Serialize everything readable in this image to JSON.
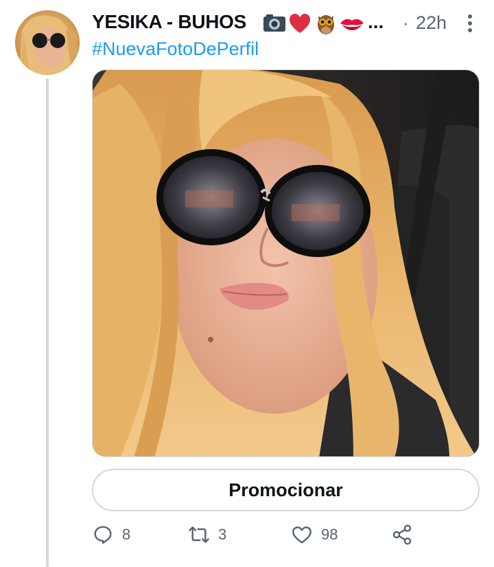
{
  "tweet": {
    "display_name": "YESIKA - BUHOS",
    "name_emojis": [
      "camera-icon",
      "red-heart-icon",
      "owl-icon",
      "kiss-mark-icon"
    ],
    "name_truncation": "...",
    "separator": "·",
    "timestamp": "22h",
    "hashtag": "#NuevaFotoDePerfil",
    "promote_label": "Promocionar",
    "actions": {
      "replies": "8",
      "retweets": "3",
      "likes": "98"
    }
  },
  "colors": {
    "link": "#1d9bf0",
    "secondary_text": "#536471",
    "border": "#cfd9de",
    "heart": "#e0245e"
  }
}
